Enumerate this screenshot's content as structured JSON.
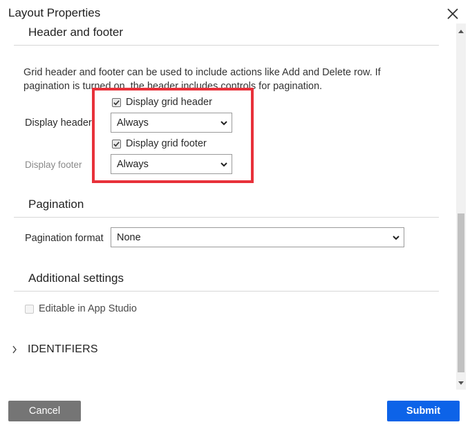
{
  "dialog": {
    "title": "Layout Properties"
  },
  "header_footer": {
    "section_title": "Header and footer",
    "description": "Grid header and footer can be used to include actions like Add and Delete row. If pagination is turned on, the header includes controls for pagination.",
    "display_header_label": "Display header",
    "display_grid_header_checkbox": {
      "label": "Display grid header",
      "checked": true
    },
    "display_header_select": {
      "value": "Always"
    },
    "display_grid_footer_checkbox": {
      "label": "Display grid footer",
      "checked": true
    },
    "display_footer_label": "Display footer",
    "display_footer_select": {
      "value": "Always"
    }
  },
  "pagination": {
    "section_title": "Pagination",
    "format_label": "Pagination format",
    "format_select": {
      "value": "None"
    }
  },
  "additional": {
    "section_title": "Additional settings",
    "editable_checkbox": {
      "label": "Editable in App Studio",
      "checked": false,
      "disabled": true
    }
  },
  "identifiers": {
    "label": "IDENTIFIERS"
  },
  "footer": {
    "cancel_label": "Cancel",
    "submit_label": "Submit"
  },
  "colors": {
    "highlight": "#e8313a",
    "submit": "#0d63e8",
    "cancel": "#757575"
  },
  "icons": [
    "close-icon",
    "checkmark-icon",
    "chevron-down-icon",
    "chevron-right-icon",
    "scroll-up-arrow-icon",
    "scroll-down-arrow-icon"
  ]
}
